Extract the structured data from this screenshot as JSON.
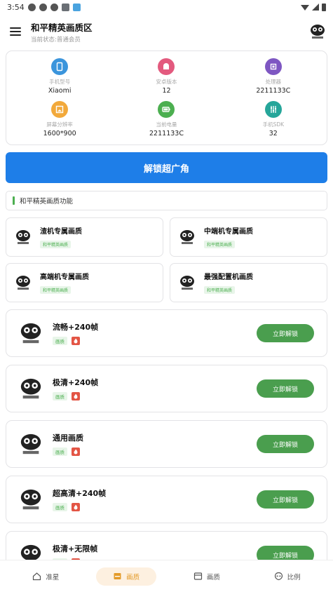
{
  "status": {
    "time": "3:54"
  },
  "appbar": {
    "title": "和平精英画质区",
    "subtitle": "当前状态:普通会员"
  },
  "device_info": [
    {
      "label": "手机型号",
      "value": "Xiaomi",
      "icon": "phone-icon",
      "color": "#3b95dc"
    },
    {
      "label": "安卓版本",
      "value": "12",
      "icon": "android-icon",
      "color": "#e35a7e"
    },
    {
      "label": "处理器",
      "value": "2211133C",
      "icon": "chip-icon",
      "color": "#7e57c2"
    },
    {
      "label": "屏幕分辨率",
      "value": "1600*900",
      "icon": "image-icon",
      "color": "#f2a93b"
    },
    {
      "label": "当前电量",
      "value": "2211133C",
      "icon": "battery-icon",
      "color": "#4caf50"
    },
    {
      "label": "手机SDK",
      "value": "32",
      "icon": "sliders-icon",
      "color": "#26a69a"
    }
  ],
  "unlock_button": "解锁超广角",
  "section_title": "和平精英画质功能",
  "quality_cards": [
    {
      "title": "渣机专属画质",
      "tag": "和平精英画质"
    },
    {
      "title": "中端机专属画质",
      "tag": "和平精英画质"
    },
    {
      "title": "高端机专属画质",
      "tag": "和平精英画质"
    },
    {
      "title": "最强配置机画质",
      "tag": "和平精英画质"
    }
  ],
  "modes": [
    {
      "name": "流畅+240帧",
      "tag": "画质",
      "button": "立即解锁"
    },
    {
      "name": "极清+240帧",
      "tag": "画质",
      "button": "立即解锁"
    },
    {
      "name": "通用画质",
      "tag": "画质",
      "button": "立即解锁"
    },
    {
      "name": "超高清+240帧",
      "tag": "画质",
      "button": "立即解锁"
    },
    {
      "name": "极清+无限帧",
      "tag": "画质",
      "button": "立即解锁"
    }
  ],
  "bottom_nav": [
    {
      "label": "准星",
      "icon": "home-icon"
    },
    {
      "label": "画质",
      "icon": "inbox-icon",
      "active": true
    },
    {
      "label": "画质",
      "icon": "window-icon"
    },
    {
      "label": "比例",
      "icon": "alien-icon"
    }
  ]
}
